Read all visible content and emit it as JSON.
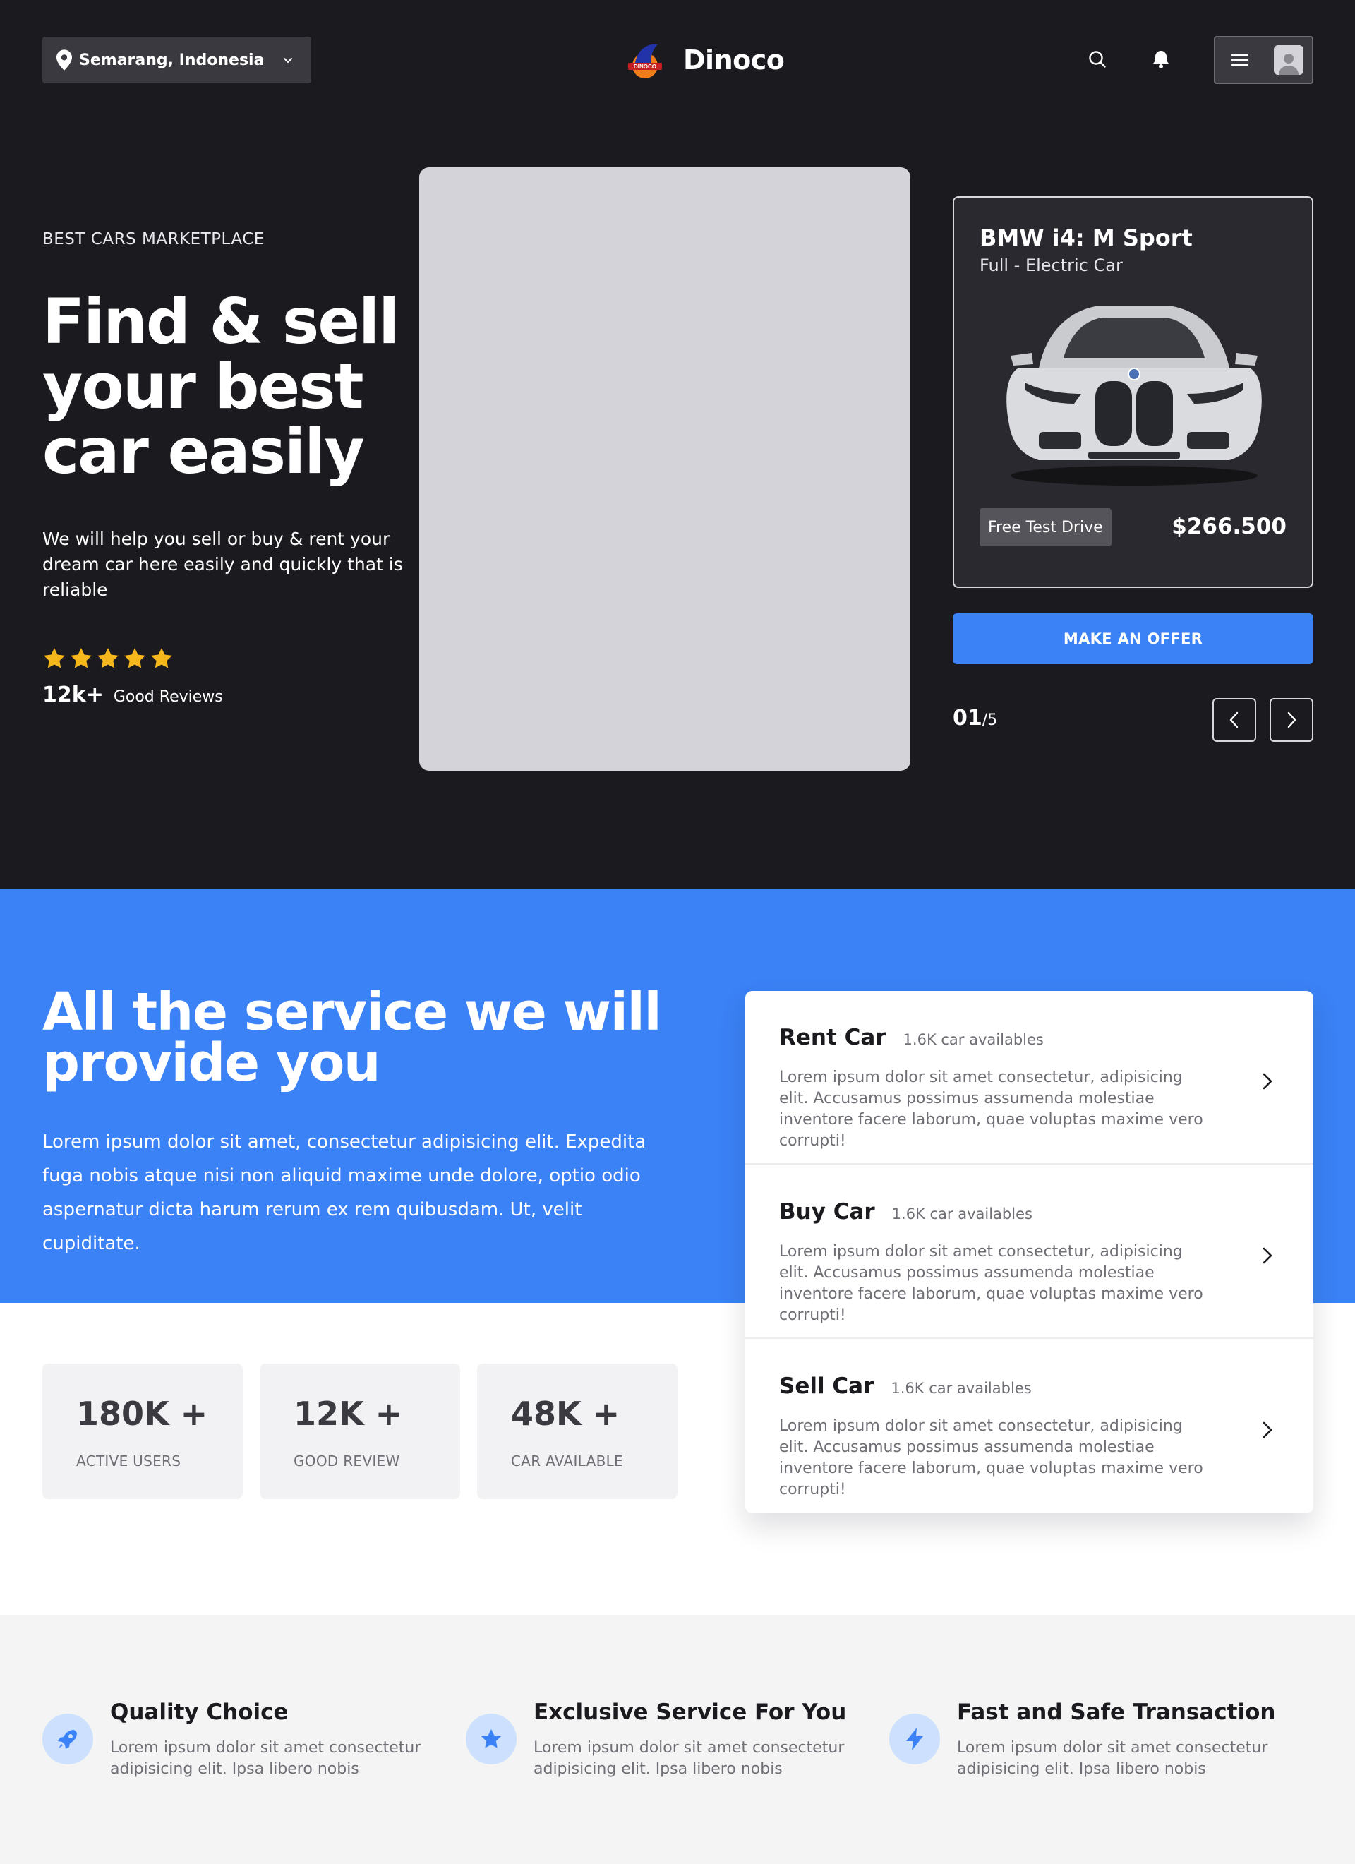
{
  "header": {
    "location": "Semarang, Indonesia",
    "brand": "Dinoco",
    "logo_text": "DINOCO"
  },
  "hero": {
    "eyebrow": "BEST CARS MARKETPLACE",
    "headline": "Find & sell your best car easily",
    "subtext": "We will help you sell or buy & rent your dream car here easily and quickly that is reliable",
    "rating_stars": 5,
    "reviews_count": "12k+",
    "reviews_label": "Good Reviews"
  },
  "featured_car": {
    "name": "BMW i4: M Sport",
    "type": "Full - Electric Car",
    "badge": "Free Test Drive",
    "price": "$266.500",
    "offer_button": "MAKE AN OFFER",
    "pager_current": "01",
    "pager_total": "/5"
  },
  "services": {
    "title": "All the service we will provide you",
    "text": "Lorem ipsum dolor sit amet, consectetur adipisicing elit. Expedita fuga nobis atque nisi non aliquid maxime unde dolore, optio odio aspernatur dicta harum rerum ex rem quibusdam. Ut, velit cupiditate.",
    "items": [
      {
        "name": "Rent Car",
        "count": "1.6K car availables",
        "desc": "Lorem ipsum dolor sit amet consectetur, adipisicing elit. Accusamus possimus assumenda molestiae inventore facere laborum, quae voluptas maxime vero corrupti!"
      },
      {
        "name": "Buy Car",
        "count": "1.6K car availables",
        "desc": "Lorem ipsum dolor sit amet consectetur, adipisicing elit. Accusamus possimus assumenda molestiae inventore facere laborum, quae voluptas maxime vero corrupti!"
      },
      {
        "name": "Sell Car",
        "count": "1.6K car availables",
        "desc": "Lorem ipsum dolor sit amet consectetur, adipisicing elit. Accusamus possimus assumenda molestiae inventore facere laborum, quae voluptas maxime vero corrupti!"
      }
    ]
  },
  "stats": [
    {
      "value": "180K +",
      "label": "ACTIVE USERS"
    },
    {
      "value": "12K +",
      "label": "GOOD REVIEW"
    },
    {
      "value": "48K +",
      "label": "CAR AVAILABLE"
    }
  ],
  "features": [
    {
      "icon": "rocket-icon",
      "title": "Quality Choice",
      "desc": "Lorem ipsum dolor sit amet consectetur adipisicing elit. Ipsa libero nobis"
    },
    {
      "icon": "star-icon",
      "title": "Exclusive Service For You",
      "desc": "Lorem ipsum dolor sit amet consectetur adipisicing elit. Ipsa libero nobis"
    },
    {
      "icon": "bolt-icon",
      "title": "Fast and Safe Transaction",
      "desc": "Lorem ipsum dolor sit amet consectetur adipisicing elit. Ipsa libero nobis"
    }
  ],
  "colors": {
    "dark_bg": "#1b1a1f",
    "accent_blue": "#3b82f6",
    "star_yellow": "#f5b71b",
    "light_bg": "#f4f4f5"
  }
}
